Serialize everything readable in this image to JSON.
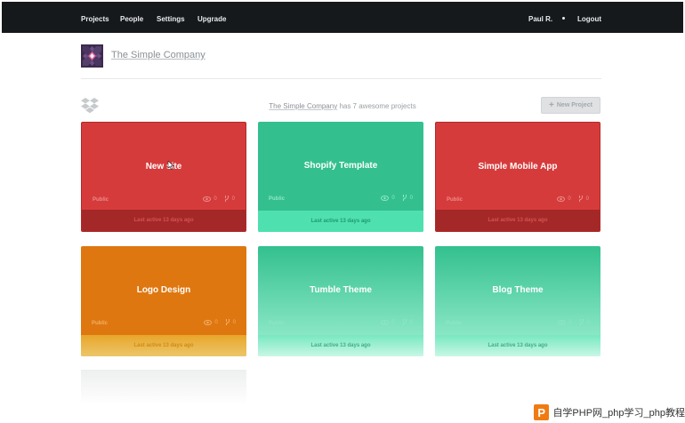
{
  "nav": {
    "left": [
      "Projects",
      "People",
      "Settings",
      "Upgrade"
    ],
    "user": "Paul R.",
    "logout": "Logout"
  },
  "company": {
    "name": "The Simple Company"
  },
  "summary": {
    "company": "The Simple Company",
    "text": "has 7 awesome projects"
  },
  "new_project_label": "New Project",
  "projects": [
    {
      "title": "New site",
      "visibility": "Public",
      "views": "0",
      "forks": "0",
      "last_active": "Last active 13 days ago",
      "color": "#d63b3b"
    },
    {
      "title": "Shopify Template",
      "visibility": "Public",
      "views": "0",
      "forks": "0",
      "last_active": "Last active 13 days ago",
      "color": "#33c08e"
    },
    {
      "title": "Simple Mobile App",
      "visibility": "Public",
      "views": "0",
      "forks": "0",
      "last_active": "Last active 13 days ago",
      "color": "#d63b3b"
    },
    {
      "title": "Logo Design",
      "visibility": "Public",
      "views": "0",
      "forks": "0",
      "last_active": "Last active 13 days ago",
      "color": "#df7710"
    },
    {
      "title": "Tumble Theme",
      "visibility": "Public",
      "views": "0",
      "forks": "0",
      "last_active": "Last active 13 days ago",
      "color": "#33c08e"
    },
    {
      "title": "Blog Theme",
      "visibility": "Public",
      "views": "0",
      "forks": "0",
      "last_active": "Last active 13 days ago",
      "color": "#33c08e"
    }
  ],
  "icons": {
    "company_logo": "diamond-logo-icon",
    "dropbox": "dropbox-icon",
    "views": "eye-icon",
    "forks": "fork-icon",
    "add": "plus-icon"
  },
  "watermark": {
    "text": "自学PHP网_php学习_php教程",
    "logo": "P"
  }
}
